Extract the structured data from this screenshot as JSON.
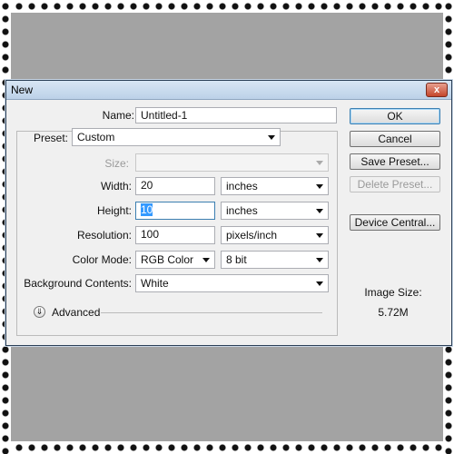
{
  "window": {
    "title": "New",
    "close_label": "x"
  },
  "form": {
    "name_label": "Name:",
    "name_value": "Untitled-1",
    "preset_label": "Preset:",
    "preset_value": "Custom",
    "size_label": "Size:",
    "size_value": "",
    "width_label": "Width:",
    "width_value": "20",
    "width_unit": "inches",
    "height_label": "Height:",
    "height_value": "10",
    "height_unit": "inches",
    "resolution_label": "Resolution:",
    "resolution_value": "100",
    "resolution_unit": "pixels/inch",
    "color_mode_label": "Color Mode:",
    "color_mode_value": "RGB Color",
    "bit_depth_value": "8 bit",
    "background_label": "Background Contents:",
    "background_value": "White",
    "advanced_label": "Advanced"
  },
  "buttons": {
    "ok": "OK",
    "cancel": "Cancel",
    "save_preset": "Save Preset...",
    "delete_preset": "Delete Preset...",
    "device_central": "Device Central..."
  },
  "image_size": {
    "label": "Image Size:",
    "value": "5.72M"
  },
  "icons": {
    "advanced": "chevron-down-circle-icon",
    "dropdown": "triangle-down-icon"
  }
}
